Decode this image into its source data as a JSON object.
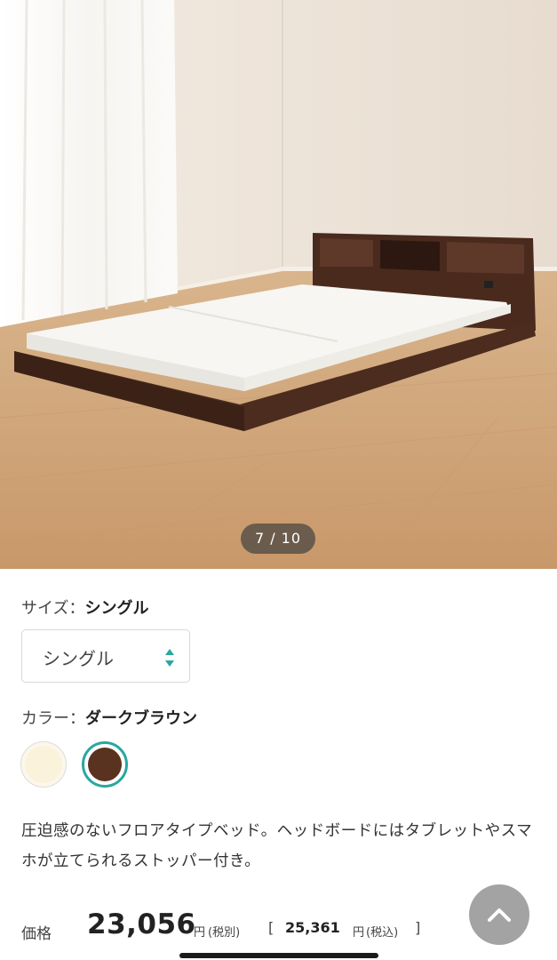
{
  "gallery": {
    "counter": "7 / 10"
  },
  "size": {
    "label": "サイズ：",
    "selected": "シングル",
    "select_value": "シングル"
  },
  "color": {
    "label": "カラー：",
    "selected": "ダークブラウン",
    "swatches": [
      {
        "name": "ivory",
        "hex": "#fbf2dc",
        "active": false
      },
      {
        "name": "dark-brown",
        "hex": "#5a3320",
        "active": true
      }
    ],
    "active_ring": "#2aa79e"
  },
  "description": "圧迫感のないフロアタイプベッド。ヘッドボードにはタブレットやスマホが立てられるストッパー付き。",
  "price": {
    "label": "価格",
    "main": "23,056",
    "unit": "円",
    "tax_note": "(税別)",
    "bracket_open": "[",
    "incl": "25,361",
    "incl_unit": "円",
    "incl_note": "(税込)",
    "bracket_close": "]"
  }
}
